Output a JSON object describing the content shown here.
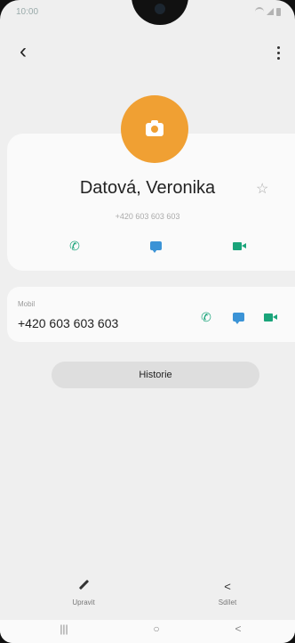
{
  "status_bar": {
    "time": "10:00"
  },
  "contact": {
    "name": "Datová, Veronika",
    "phone_small": "+420 603 603 603"
  },
  "mobile": {
    "label": "Mobil",
    "number": "+420 603 603 603"
  },
  "history_button": "Historie",
  "bottom_bar": {
    "edit_label": "Upravit",
    "share_label": "Sdílet"
  },
  "nav": {
    "recents": "|||",
    "home": "○",
    "back": "<"
  },
  "icons": {
    "back": "back-arrow-icon",
    "more": "more-vertical-icon",
    "avatar": "camera-icon",
    "favorite": "star-icon",
    "call": "phone-icon",
    "message": "message-icon",
    "video": "video-icon",
    "edit": "pencil-icon",
    "share": "share-icon"
  },
  "colors": {
    "avatar": "#f0a033",
    "call": "#1aa47a",
    "message": "#3b93d6",
    "video": "#1aa47a"
  }
}
